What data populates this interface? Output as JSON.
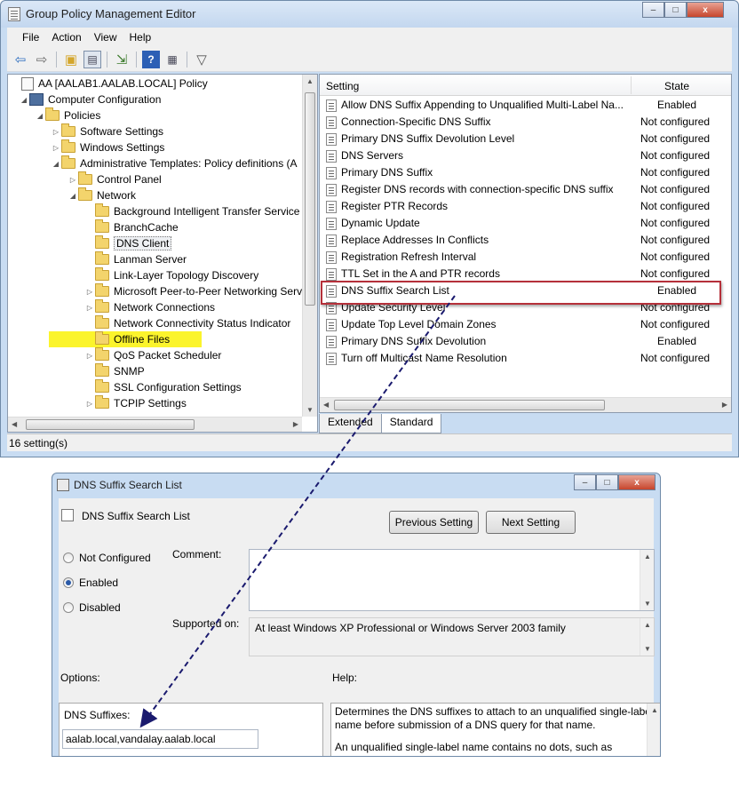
{
  "window": {
    "title": "Group Policy Management Editor",
    "menu": [
      "File",
      "Action",
      "View",
      "Help"
    ],
    "toolbar_icons": [
      "back-arrow-icon",
      "forward-arrow-icon",
      "up-folder-icon",
      "show-hide-tree-icon",
      "export-list-icon",
      "help-icon",
      "properties-icon",
      "filter-icon"
    ],
    "controls": {
      "minimize": "–",
      "maximize": "□",
      "close": "x"
    }
  },
  "tree": {
    "items": [
      {
        "label": "AA [AALAB1.AALAB.LOCAL] Policy",
        "icon": "policy-icon",
        "arrow": ""
      },
      {
        "label": "Computer Configuration",
        "icon": "computer-icon",
        "arrow": "◢"
      },
      {
        "label": "Policies",
        "icon": "folder-icon",
        "arrow": "◢"
      },
      {
        "label": "Software Settings",
        "icon": "folder-icon",
        "arrow": "▷"
      },
      {
        "label": "Windows Settings",
        "icon": "folder-icon",
        "arrow": "▷"
      },
      {
        "label": "Administrative Templates: Policy definitions (A",
        "icon": "folder-icon",
        "arrow": "◢"
      },
      {
        "label": "Control Panel",
        "icon": "folder-icon",
        "arrow": "▷"
      },
      {
        "label": "Network",
        "icon": "folder-icon",
        "arrow": "◢"
      },
      {
        "label": "Background Intelligent Transfer Service",
        "icon": "folder-icon",
        "arrow": ""
      },
      {
        "label": "BranchCache",
        "icon": "folder-icon",
        "arrow": ""
      },
      {
        "label": "DNS Client",
        "icon": "folder-icon",
        "arrow": ""
      },
      {
        "label": "Lanman Server",
        "icon": "folder-icon",
        "arrow": ""
      },
      {
        "label": "Link-Layer Topology Discovery",
        "icon": "folder-icon",
        "arrow": ""
      },
      {
        "label": "Microsoft Peer-to-Peer Networking Serv",
        "icon": "folder-icon",
        "arrow": "▷"
      },
      {
        "label": "Network Connections",
        "icon": "folder-icon",
        "arrow": "▷"
      },
      {
        "label": "Network Connectivity Status Indicator",
        "icon": "folder-icon",
        "arrow": ""
      },
      {
        "label": "Offline Files",
        "icon": "folder-icon",
        "arrow": ""
      },
      {
        "label": "QoS Packet Scheduler",
        "icon": "folder-icon",
        "arrow": "▷"
      },
      {
        "label": "SNMP",
        "icon": "folder-icon",
        "arrow": ""
      },
      {
        "label": "SSL Configuration Settings",
        "icon": "folder-icon",
        "arrow": ""
      },
      {
        "label": "TCPIP Settings",
        "icon": "folder-icon",
        "arrow": "▷"
      }
    ]
  },
  "list": {
    "headers": {
      "setting": "Setting",
      "state": "State"
    },
    "rows": [
      {
        "name": "Allow DNS Suffix Appending to Unqualified Multi-Label Na...",
        "state": "Enabled"
      },
      {
        "name": "Connection-Specific DNS Suffix",
        "state": "Not configured"
      },
      {
        "name": "Primary DNS Suffix Devolution Level",
        "state": "Not configured"
      },
      {
        "name": "DNS Servers",
        "state": "Not configured"
      },
      {
        "name": "Primary DNS Suffix",
        "state": "Not configured"
      },
      {
        "name": "Register DNS records with connection-specific DNS suffix",
        "state": "Not configured"
      },
      {
        "name": "Register PTR Records",
        "state": "Not configured"
      },
      {
        "name": "Dynamic Update",
        "state": "Not configured"
      },
      {
        "name": "Replace Addresses In Conflicts",
        "state": "Not configured"
      },
      {
        "name": "Registration Refresh Interval",
        "state": "Not configured"
      },
      {
        "name": "TTL Set in the A and PTR records",
        "state": "Not configured"
      },
      {
        "name": "DNS Suffix Search List",
        "state": "Enabled"
      },
      {
        "name": "Update Security Level",
        "state": "Not configured"
      },
      {
        "name": "Update Top Level Domain Zones",
        "state": "Not configured"
      },
      {
        "name": "Primary DNS Suffix Devolution",
        "state": "Enabled"
      },
      {
        "name": "Turn off Multicast Name Resolution",
        "state": "Not configured"
      }
    ]
  },
  "tabs": [
    "Extended",
    "Standard"
  ],
  "status": "16 setting(s)",
  "dialog": {
    "title": "DNS Suffix Search List",
    "setting_name": "DNS Suffix Search List",
    "previous_button": "Previous Setting",
    "next_button": "Next Setting",
    "radios": [
      {
        "label": "Not Configured",
        "checked": false
      },
      {
        "label": "Enabled",
        "checked": true
      },
      {
        "label": "Disabled",
        "checked": false
      }
    ],
    "comment_label": "Comment:",
    "comment_value": "",
    "supported_label": "Supported on:",
    "supported_value": "At least Windows XP Professional or Windows Server 2003 family",
    "options_label": "Options:",
    "help_label": "Help:",
    "suffixes_label": "DNS Suffixes:",
    "suffixes_value": "aalab.local,vandalay.aalab.local",
    "help_para1": "Determines the DNS suffixes to attach to an unqualified single-label name before submission of a DNS query for that name.",
    "help_para2": "An unqualified single-label name contains no dots, such as"
  },
  "colors": {
    "highlight": "#fbf42c",
    "callout_box": "#b5303a",
    "arrow": "#1a1a6e"
  }
}
